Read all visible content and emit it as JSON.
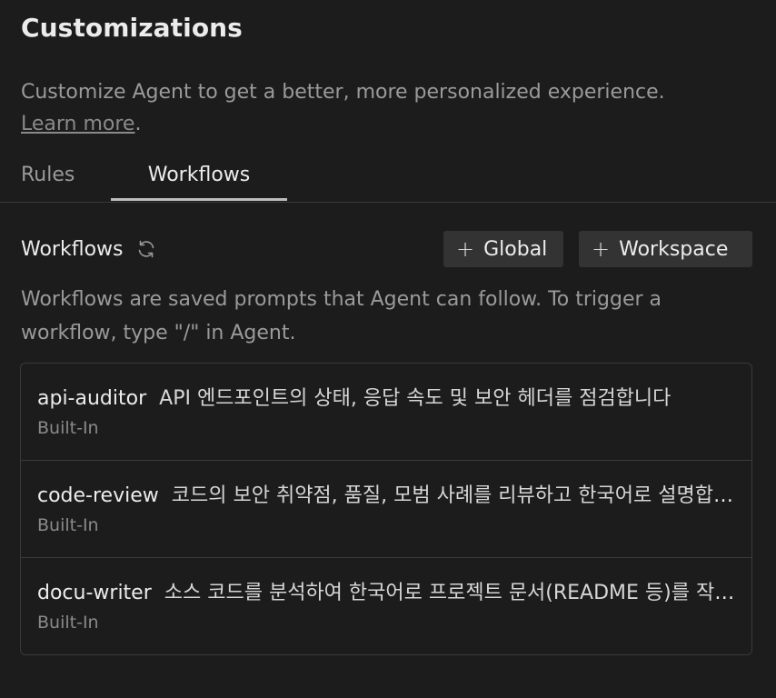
{
  "header": {
    "title": "Customizations",
    "subtitle": "Customize Agent to get a better, more personalized experience.",
    "learn_more": "Learn more",
    "learn_more_suffix": "."
  },
  "tabs": [
    {
      "label": "Rules",
      "active": false
    },
    {
      "label": "Workflows",
      "active": true
    }
  ],
  "section": {
    "title": "Workflows",
    "refresh_icon": "refresh-icon",
    "buttons": {
      "global": "Global",
      "workspace": "Workspace"
    },
    "description": "Workflows are saved prompts that Agent can follow. To trigger a workflow, type \"/\" in Agent."
  },
  "workflows": [
    {
      "name": "api-auditor",
      "description": "API 엔드포인트의 상태, 응답 속도 및 보안 헤더를 점검합니다",
      "tag": "Built-In"
    },
    {
      "name": "code-review",
      "description": "코드의 보안 취약점, 품질, 모범 사례를 리뷰하고 한국어로 설명합니다",
      "tag": "Built-In"
    },
    {
      "name": "docu-writer",
      "description": "소스 코드를 분석하여 한국어로 프로젝트 문서(README 등)를 작성합니다",
      "tag": "Built-In"
    }
  ],
  "colors": {
    "background": "#1c1c1c",
    "button_bg": "#333333",
    "border": "#3a3a3a",
    "text_primary": "#ececec",
    "text_secondary": "#9a9a9a"
  }
}
